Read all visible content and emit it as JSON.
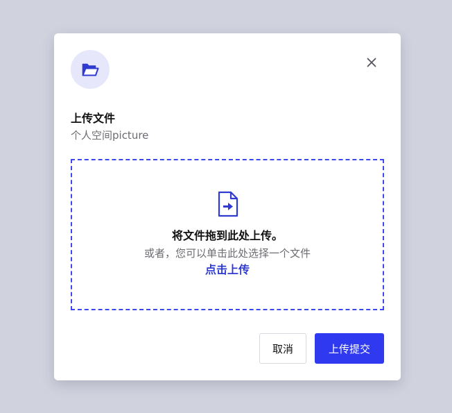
{
  "dialog": {
    "title": "上传文件",
    "subtitle": "个人空间picture",
    "header_icon": "folder-open-icon",
    "close_icon": "close-icon"
  },
  "dropzone": {
    "icon": "file-arrow-icon",
    "main_text": "将文件拖到此处上传。",
    "sub_text": "或者，您可以单击此处选择一个文件",
    "link_text": "点击上传"
  },
  "footer": {
    "cancel_label": "取消",
    "submit_label": "上传提交"
  },
  "colors": {
    "accent": "#2f3af0",
    "icon_bg": "#e6e7fb",
    "backdrop": "#d0d2de"
  }
}
